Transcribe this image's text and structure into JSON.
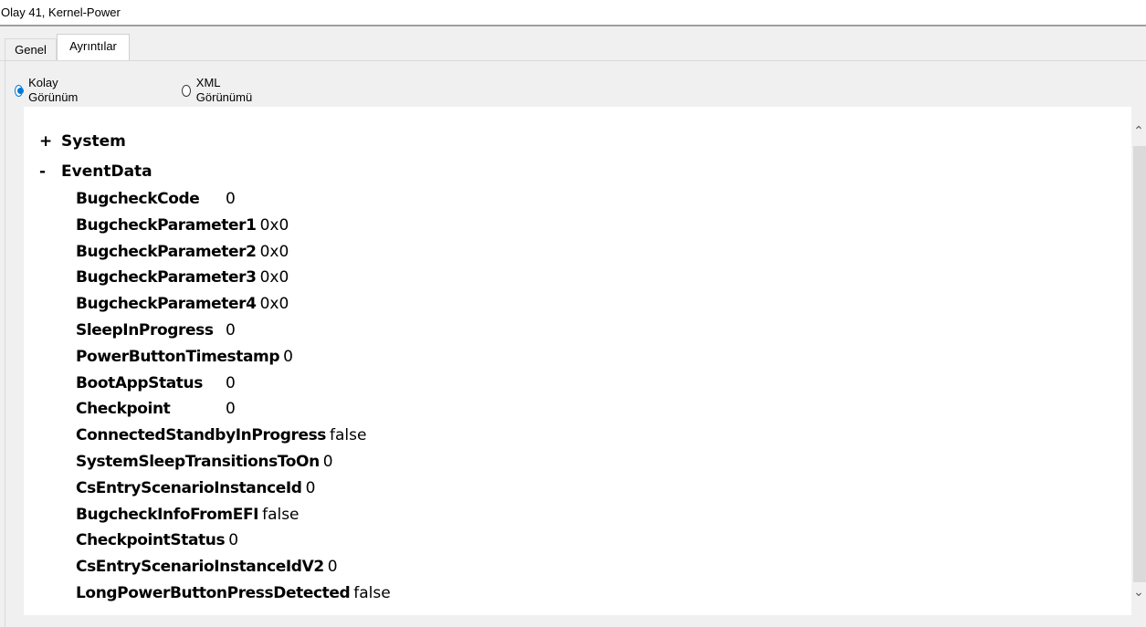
{
  "window": {
    "title": "Olay 41, Kernel-Power"
  },
  "tabs": [
    {
      "label": "Genel"
    },
    {
      "label": "Ayrıntılar"
    }
  ],
  "view": {
    "options": [
      {
        "label": "Kolay Görünüm",
        "selected": true
      },
      {
        "label": "XML Görünümü",
        "selected": false
      }
    ]
  },
  "tree": {
    "system": {
      "toggle": "+",
      "label": "System"
    },
    "eventdata": {
      "toggle": "-",
      "label": "EventData"
    },
    "fields": [
      {
        "name": "BugcheckCode",
        "value": "0"
      },
      {
        "name": "BugcheckParameter1",
        "value": "0x0"
      },
      {
        "name": "BugcheckParameter2",
        "value": "0x0"
      },
      {
        "name": "BugcheckParameter3",
        "value": "0x0"
      },
      {
        "name": "BugcheckParameter4",
        "value": "0x0"
      },
      {
        "name": "SleepInProgress",
        "value": "0"
      },
      {
        "name": "PowerButtonTimestamp",
        "value": "0"
      },
      {
        "name": "BootAppStatus",
        "value": "0"
      },
      {
        "name": "Checkpoint",
        "value": "0"
      },
      {
        "name": "ConnectedStandbyInProgress",
        "value": "false"
      },
      {
        "name": "SystemSleepTransitionsToOn",
        "value": "0"
      },
      {
        "name": "CsEntryScenarioInstanceId",
        "value": "0"
      },
      {
        "name": "BugcheckInfoFromEFI",
        "value": "false"
      },
      {
        "name": "CheckpointStatus",
        "value": "0"
      },
      {
        "name": "CsEntryScenarioInstanceIdV2",
        "value": "0"
      },
      {
        "name": "LongPowerButtonPressDetected",
        "value": "false"
      }
    ]
  },
  "scrollbar": {
    "up_icon": "chevron-up-icon",
    "down_icon": "chevron-down-icon"
  }
}
